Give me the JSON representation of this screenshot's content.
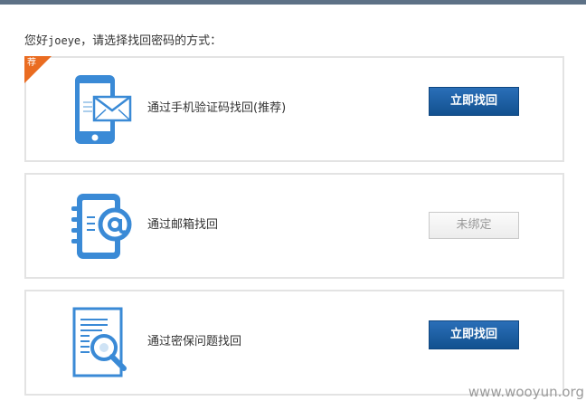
{
  "greeting": {
    "prefix": "您好",
    "username": "joeye",
    "suffix": "，请选择找回密码的方式："
  },
  "colors": {
    "accent": "#1f62a8",
    "icon_blue": "#3a8ad6",
    "badge": "#ea6c21",
    "card_border": "#e3e3e3"
  },
  "options": [
    {
      "icon": "phone-mail-icon",
      "badge": "荐",
      "label": "通过手机验证码找回(推荐)",
      "button": "立即找回",
      "enabled": true
    },
    {
      "icon": "email-notebook-icon",
      "label": "通过邮箱找回",
      "button": "未绑定",
      "enabled": false
    },
    {
      "icon": "document-search-icon",
      "label": "通过密保问题找回",
      "button": "立即找回",
      "enabled": true
    }
  ],
  "watermark": "www.wooyun.org"
}
